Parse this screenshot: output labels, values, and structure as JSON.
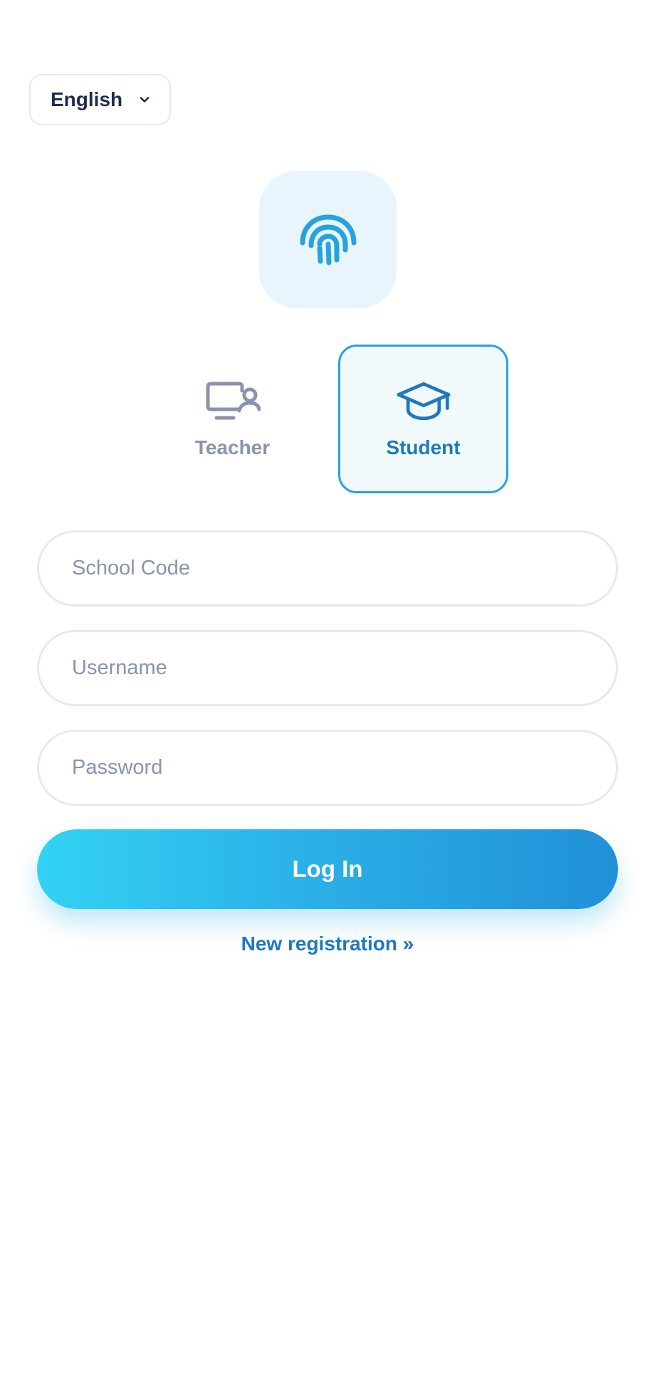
{
  "language": {
    "selected": "English",
    "icon": "chevron-down-icon"
  },
  "logo": {
    "icon": "fingerprint-icon",
    "accent": "#26a3de",
    "tile_color": "#e8f5fd"
  },
  "roles": [
    {
      "label": "Teacher",
      "icon": "teacher-screen-icon",
      "selected": false
    },
    {
      "label": "Student",
      "icon": "graduation-cap-icon",
      "selected": true
    }
  ],
  "form": {
    "school_code_placeholder": "School Code",
    "username_placeholder": "Username",
    "password_placeholder": "Password",
    "school_code_value": "",
    "username_value": "",
    "password_value": ""
  },
  "actions": {
    "login_label": "Log In",
    "register_label": "New registration »"
  },
  "colors": {
    "primary_text": "#1f2d4d",
    "muted": "#8a93ad",
    "link": "#1e78c0",
    "button_start": "#33d2f4",
    "button_end": "#2190d8"
  }
}
